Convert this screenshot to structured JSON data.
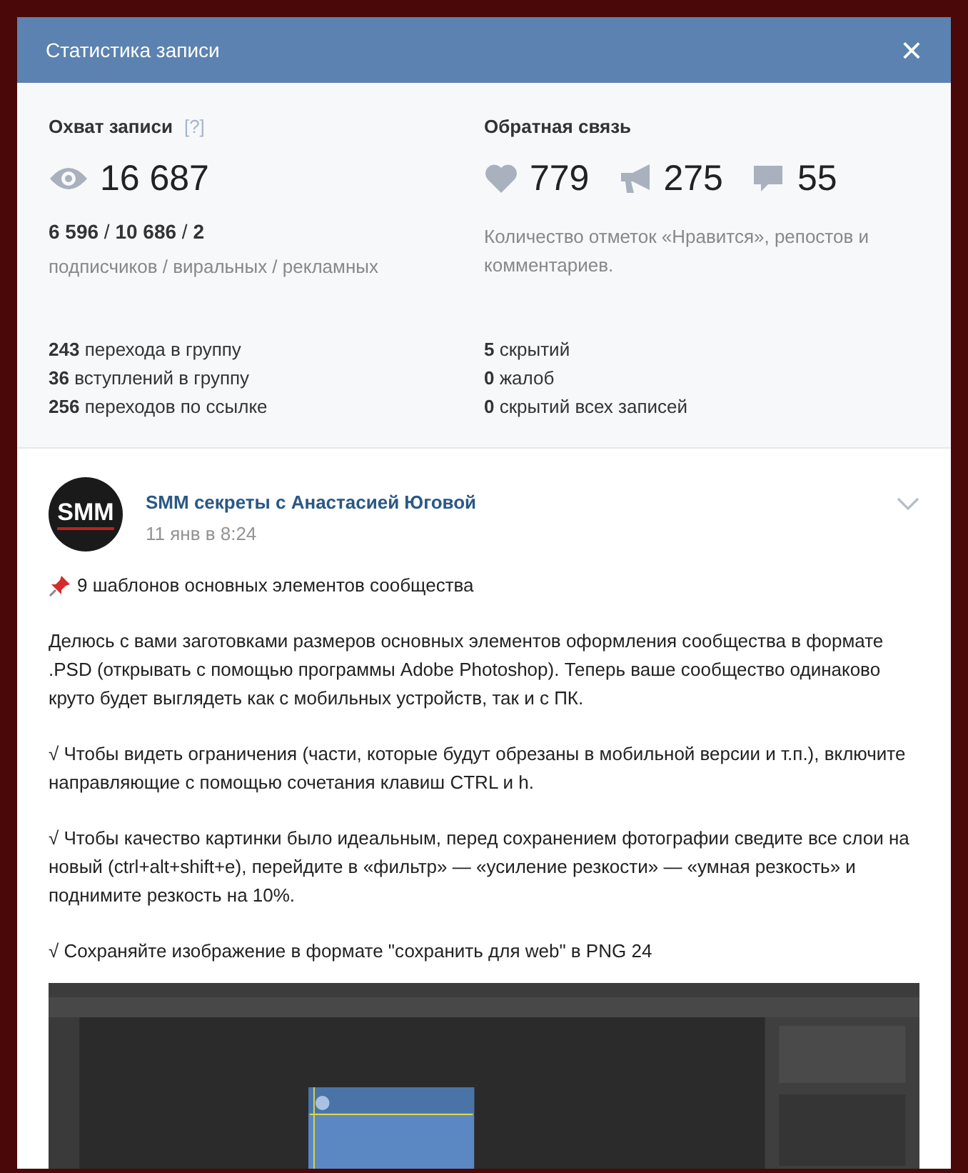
{
  "modal": {
    "title": "Статистика записи",
    "close": "×"
  },
  "reach": {
    "title": "Охват записи",
    "help": "[?]",
    "total": "16 687",
    "split": "**6 596** / **10 686** / **2**",
    "split_caption": "подписчиков / виральных / рекламных"
  },
  "feedback": {
    "title": "Обратная связь",
    "counters": [
      {
        "kind": "like",
        "value": "779"
      },
      {
        "kind": "repost",
        "value": "275"
      },
      {
        "kind": "comment",
        "value": "55"
      }
    ],
    "caption": "Количество отметок «Нравится», репостов и комментариев."
  },
  "left_stats": [
    "**243** перехода в группу",
    "**36** вступлений в группу",
    "**256** переходов по ссылке"
  ],
  "right_stats": [
    "**5** скрытий",
    "**0** жалоб",
    "**0** скрытий всех записей"
  ],
  "post": {
    "avatar_text": "SMM",
    "author": "SMM секреты с Анастасией Юговой",
    "date": "11 янв в 8:24",
    "paragraphs": [
      {
        "kind": "pinned",
        "text": "9 шаблонов основных элементов сообщества"
      },
      {
        "kind": "plain",
        "text": "Делюсь с вами заготовками размеров основных элементов оформления сообщества в формате .PSD (открывать с помощью программы Adobe Photoshop). Теперь ваше сообщество одинаково круто будет выглядеть как с мобильных устройств, так и с ПК."
      },
      {
        "kind": "plain",
        "text": "√ Чтобы видеть ограничения (части, которые будут обрезаны в мобильной версии и т.п.), включите направляющие с помощью сочетания клавиш CTRL и h."
      },
      {
        "kind": "plain",
        "text": "√ Чтобы качество картинки было идеальным, перед сохранением фотографии сведите все слои на новый (ctrl+alt+shift+e), перейдите в «фильтр» — «усиление резкости» — «умная резкость» и поднимите резкость на 10%."
      },
      {
        "kind": "plain",
        "text": "√ Сохраняйте изображение в формате \"сохранить для web\" в PNG 24"
      }
    ]
  }
}
